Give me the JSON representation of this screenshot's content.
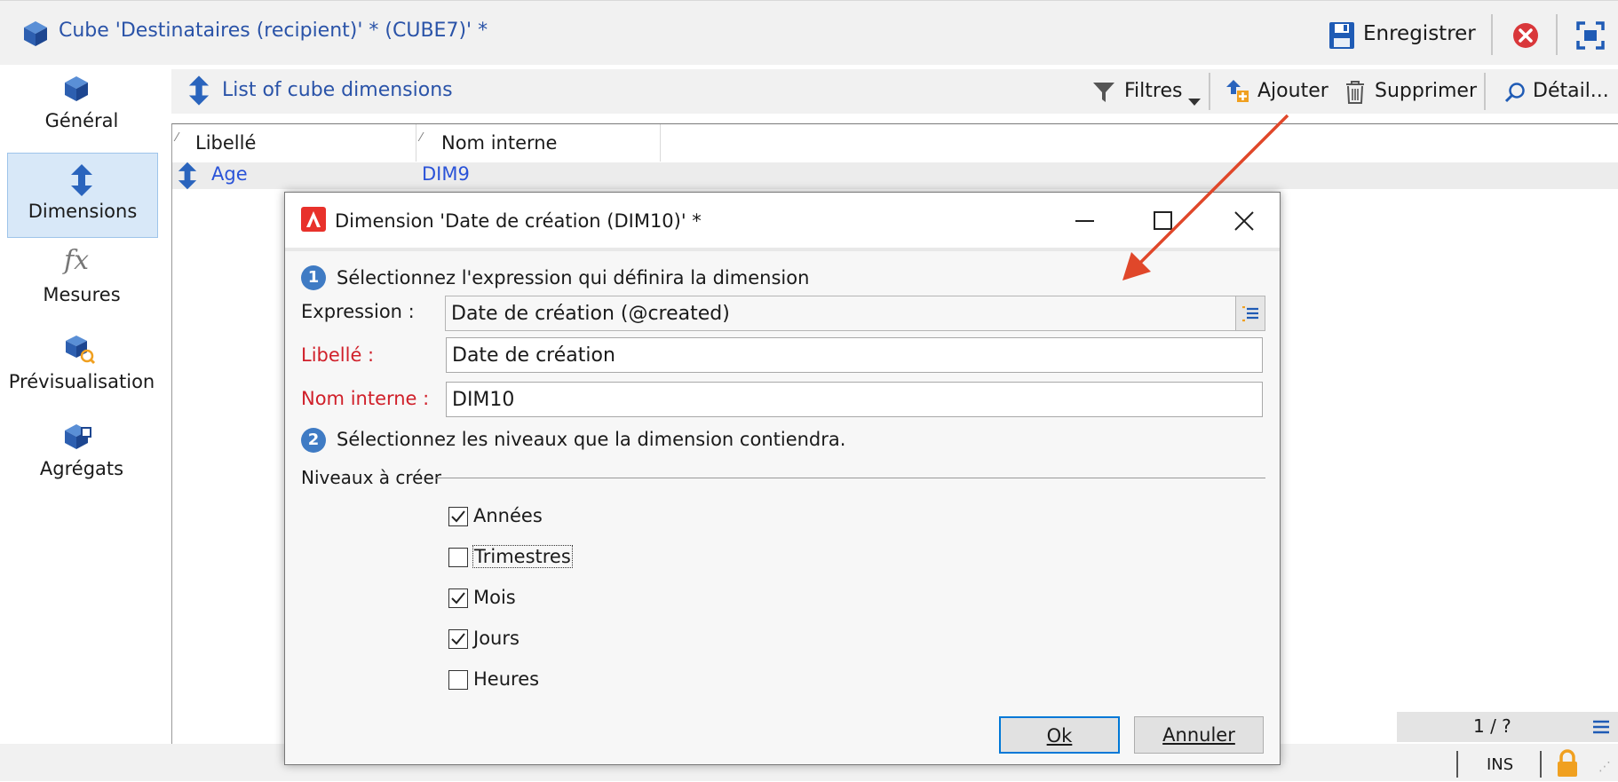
{
  "window": {
    "title": "Cube 'Destinataires (recipient)' * (CUBE7)' *",
    "save_label": "Enregistrer"
  },
  "nav": {
    "items": [
      {
        "label": "Général"
      },
      {
        "label": "Dimensions"
      },
      {
        "label": "Mesures"
      },
      {
        "label": "Prévisualisation"
      },
      {
        "label": "Agrégats"
      }
    ]
  },
  "list": {
    "title": "List of cube dimensions",
    "toolbar": {
      "filters": "Filtres",
      "add": "Ajouter",
      "delete": "Supprimer",
      "detail": "Détail..."
    },
    "columns": [
      "Libellé",
      "Nom interne"
    ],
    "rows": [
      {
        "label": "Age",
        "internal": "DIM9"
      }
    ],
    "pagination": "1 / ?"
  },
  "statusbar": {
    "mode": "INS"
  },
  "dialog": {
    "title": "Dimension 'Date de création (DIM10)' *",
    "step1": {
      "num": "1",
      "text": "Sélectionnez l'expression qui définira la dimension"
    },
    "expression_label": "Expression :",
    "expression_value": "Date de création (@created)",
    "libelle_label": "Libellé :",
    "libelle_value": "Date de création",
    "nom_label": "Nom interne :",
    "nom_value": "DIM10",
    "step2": {
      "num": "2",
      "text": "Sélectionnez les niveaux que la dimension contiendra."
    },
    "levels_group": "Niveaux à créer",
    "levels": [
      {
        "label": "Années",
        "checked": true
      },
      {
        "label": "Trimestres",
        "checked": false
      },
      {
        "label": "Mois",
        "checked": true
      },
      {
        "label": "Jours",
        "checked": true
      },
      {
        "label": "Heures",
        "checked": false
      }
    ],
    "ok_label": "Ok",
    "cancel_label": "Annuler"
  },
  "colors": {
    "accent": "#2a53a8",
    "required_label": "#d0202a",
    "annotation_arrow": "#e0472a",
    "selection": "#d8e8f8"
  }
}
